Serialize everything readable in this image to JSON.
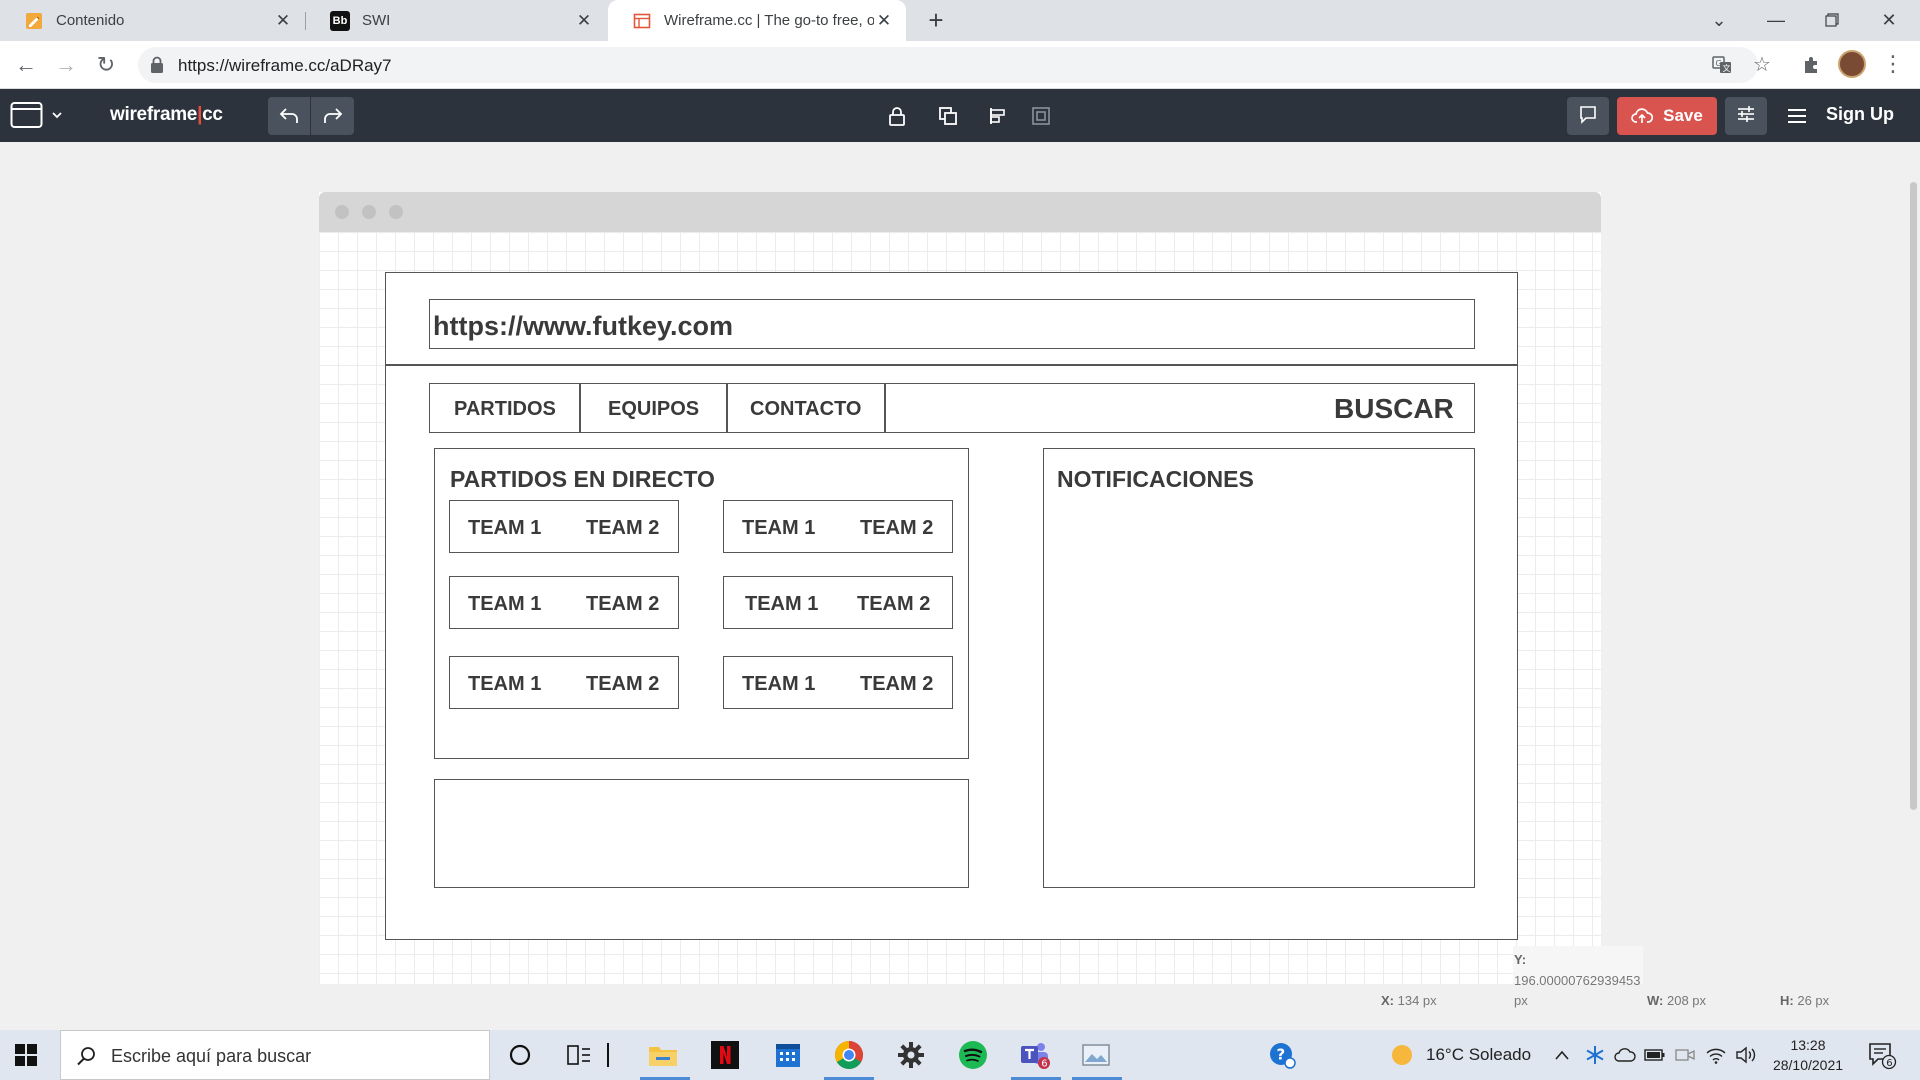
{
  "browser": {
    "tabs": [
      {
        "title": "Contenido",
        "favicon": "pencil-note-icon"
      },
      {
        "title": "SWI",
        "favicon": "blackboard-icon",
        "favicon_text": "Bb"
      },
      {
        "title": "Wireframe.cc | The go-to free, on",
        "favicon": "wireframe-icon",
        "active": true
      }
    ],
    "address_url": "https://wireframe.cc/aDRay7"
  },
  "app": {
    "logo_main": "wireframe",
    "logo_sep": "|",
    "logo_suffix": "cc",
    "save_label": "Save",
    "signup_label": "Sign Up"
  },
  "wireframe": {
    "url_bar": "https://www.futkey.com",
    "nav": [
      "PARTIDOS",
      "EQUIPOS",
      "CONTACTO"
    ],
    "search": "BUSCAR",
    "live_title": "PARTIDOS EN DIRECTO",
    "notifications_title": "NOTIFICACIONES",
    "matches": [
      {
        "home": "TEAM 1",
        "away": "TEAM 2"
      },
      {
        "home": "TEAM 1",
        "away": "TEAM 2"
      },
      {
        "home": "TEAM 1",
        "away": "TEAM 2"
      },
      {
        "home": "TEAM 1",
        "away": "TEAM 2"
      },
      {
        "home": "TEAM 1",
        "away": "TEAM 2"
      },
      {
        "home": "TEAM 1",
        "away": "TEAM 2"
      }
    ]
  },
  "status": {
    "x_label": "X:",
    "x_value": "134 px",
    "y_label": "Y:",
    "y_value": "196.00000762939453",
    "y_unit": "px",
    "w_label": "W:",
    "w_value": "208 px",
    "h_label": "H:",
    "h_value": "26 px"
  },
  "taskbar": {
    "search_placeholder": "Escribe aquí para buscar",
    "weather": "16°C  Soleado",
    "time": "13:28",
    "date": "28/10/2021",
    "teams_badge": "6",
    "notif_badge": "6"
  },
  "colors": {
    "toolbar_bg": "#2c333d",
    "save_red": "#d9534f",
    "logo_bar_red": "#e74c3c"
  }
}
